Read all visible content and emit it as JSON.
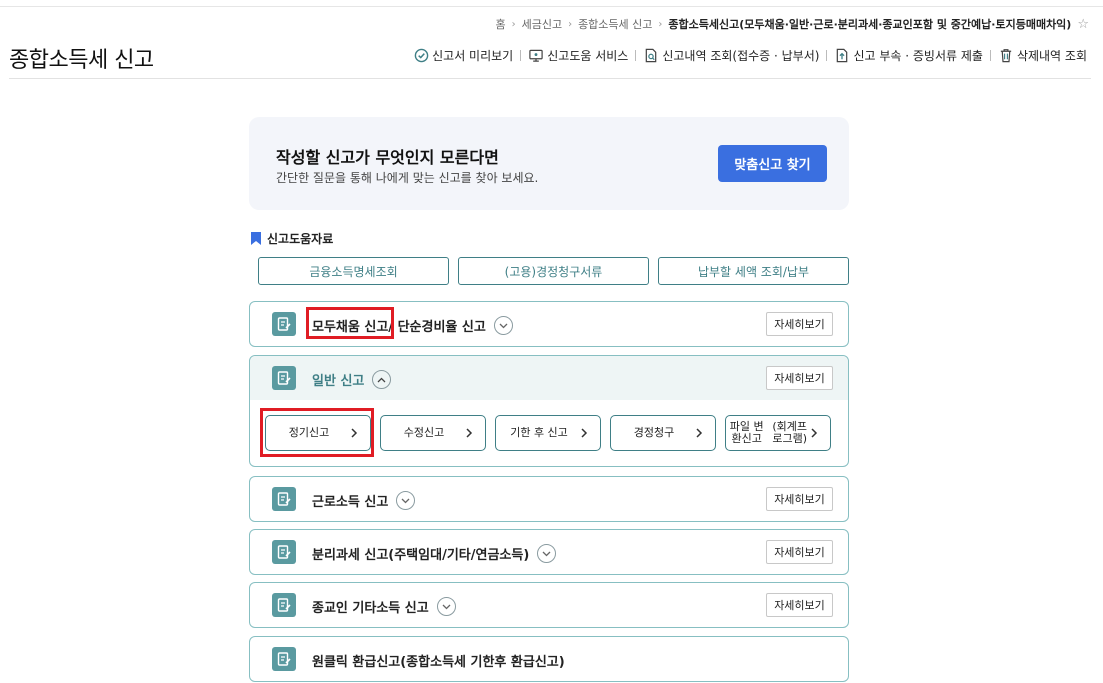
{
  "breadcrumb": {
    "items": [
      "홈",
      "세금신고",
      "종합소득세 신고"
    ],
    "current": "종합소득세신고(모두채움·일반·근로·분리과세·종교인포함 및 중간예납·토지등매매차익)",
    "favorite_icon": "star-outline-icon"
  },
  "page_title": "종합소득세 신고",
  "top_menu": [
    {
      "label": "신고서 미리보기",
      "icon": "check-circle-icon"
    },
    {
      "label": "신고도움 서비스",
      "icon": "monitor-icon"
    },
    {
      "label": "신고내역 조회(접수증 · 납부서)",
      "icon": "document-search-icon"
    },
    {
      "label": "신고 부속 · 증빙서류 제출",
      "icon": "upload-document-icon"
    },
    {
      "label": "삭제내역 조회",
      "icon": "trash-icon"
    }
  ],
  "promo": {
    "title": "작성할 신고가 무엇인지 모른다면",
    "subtitle": "간단한 질문을 통해 나에게 맞는 신고를 찾아 보세요.",
    "button": "맞춤신고 찾기"
  },
  "help": {
    "title": "신고도움자료",
    "buttons": [
      "금융소득명세조회",
      "(고용)경정청구서류",
      "납부할 세액 조회/납부"
    ]
  },
  "sections": [
    {
      "title_a": "모두채움 신고",
      "title_b": " / 단순경비율 신고",
      "detail": "자세히보기"
    },
    {
      "title_a": "일반 신고",
      "detail": "자세히보기",
      "sub_buttons": [
        {
          "label": "정기신고"
        },
        {
          "label": "수정신고"
        },
        {
          "label": "기한 후 신고"
        },
        {
          "label": "경정청구"
        },
        {
          "label_line1": "파일 변환신고",
          "label_line2": "(회계프로그램)"
        }
      ]
    },
    {
      "title_a": "근로소득 신고",
      "detail": "자세히보기"
    },
    {
      "title_a": "분리과세 신고(주택임대/기타/연금소득)",
      "detail": "자세히보기"
    },
    {
      "title_a": "종교인 기타소득 신고",
      "detail": "자세히보기"
    },
    {
      "title_a": "원클릭 환급신고(종합소득세 기한후 환급신고)"
    }
  ],
  "colors": {
    "accent": "#3a6fe0",
    "teal": "#3f7f86",
    "highlight": "#e01c24"
  }
}
